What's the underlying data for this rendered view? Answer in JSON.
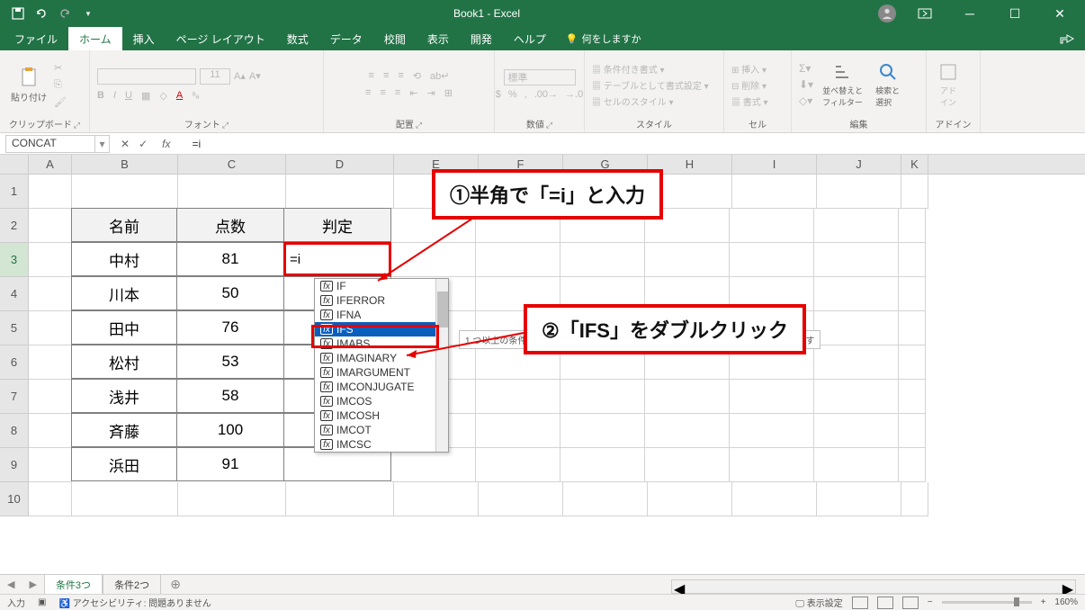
{
  "titlebar": {
    "title": "Book1 - Excel"
  },
  "tabs": {
    "file": "ファイル",
    "home": "ホーム",
    "insert": "挿入",
    "layout": "ページ レイアウト",
    "formulas": "数式",
    "data": "データ",
    "review": "校閲",
    "view": "表示",
    "dev": "開発",
    "help": "ヘルプ",
    "tellme": "何をしますか"
  },
  "ribbon": {
    "clipboard": {
      "label": "クリップボード",
      "paste": "貼り付け"
    },
    "font": {
      "label": "フォント",
      "size": "11"
    },
    "alignment": {
      "label": "配置"
    },
    "number": {
      "label": "数値",
      "format": "標準"
    },
    "styles": {
      "label": "スタイル",
      "cond": "条件付き書式",
      "table": "テーブルとして書式設定",
      "cell": "セルのスタイル"
    },
    "cells": {
      "label": "セル",
      "insert": "挿入",
      "delete": "削除",
      "format": "書式"
    },
    "editing": {
      "label": "編集",
      "sort": "並べ替えと\nフィルター",
      "find": "検索と\n選択"
    },
    "addin": {
      "label": "アドイン",
      "btn": "アド\nイン"
    }
  },
  "namebox": "CONCAT",
  "formula": "=i",
  "columns": [
    "A",
    "B",
    "C",
    "D",
    "E",
    "F",
    "G",
    "H",
    "I",
    "J",
    "K"
  ],
  "rows": [
    "1",
    "2",
    "3",
    "4",
    "5",
    "6",
    "7",
    "8",
    "9",
    "10"
  ],
  "table": {
    "headers": {
      "b": "名前",
      "c": "点数",
      "d": "判定"
    },
    "rows": [
      {
        "b": "中村",
        "c": "81",
        "d": "=i"
      },
      {
        "b": "川本",
        "c": "50"
      },
      {
        "b": "田中",
        "c": "76"
      },
      {
        "b": "松村",
        "c": "53"
      },
      {
        "b": "浅井",
        "c": "58"
      },
      {
        "b": "斉藤",
        "c": "100"
      },
      {
        "b": "浜田",
        "c": "91"
      }
    ]
  },
  "autocomplete": [
    "IF",
    "IFERROR",
    "IFNA",
    "IFS",
    "IMABS",
    "IMAGINARY",
    "IMARGUMENT",
    "IMCONJUGATE",
    "IMCOS",
    "IMCOSH",
    "IMCOT",
    "IMCSC"
  ],
  "ac_selected": 3,
  "tooltip": "1 つ以上の条件が満たされるかどうかを確認し、最初の真条件に対応する値を返します",
  "callout1": "①半角で「=i」と入力",
  "callout2": "②「IFS」をダブルクリック",
  "sheets": {
    "active": "条件3つ",
    "other": "条件2つ"
  },
  "statusbar": {
    "mode": "入力",
    "access": "アクセシビリティ: 問題ありません",
    "display": "表示設定",
    "zoom": "160%"
  }
}
